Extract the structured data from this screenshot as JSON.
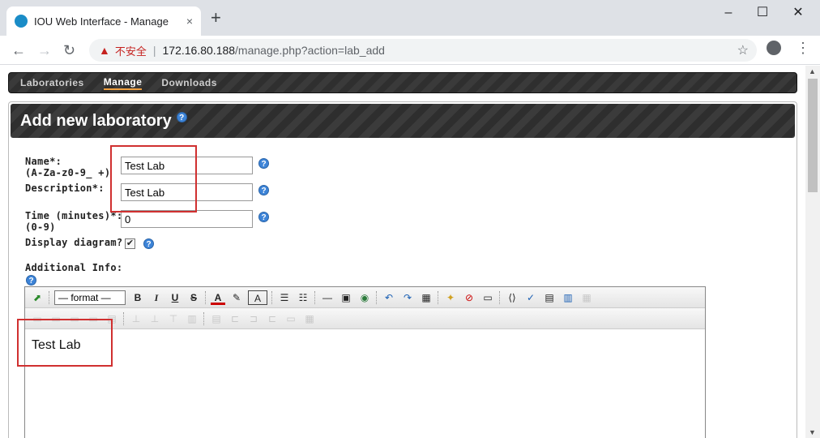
{
  "browser": {
    "tab_title": "IOU Web Interface - Manage",
    "tab_close": "×",
    "new_tab": "+",
    "insecure_label": "不安全",
    "url_host": "172.16.80.188",
    "url_path": "/manage.php?action=lab_add",
    "win_minimize": "–",
    "win_maximize": "☐",
    "win_close": "✕"
  },
  "nav": {
    "items": [
      "Laboratories",
      "Manage",
      "Downloads"
    ],
    "active": "Manage"
  },
  "panel": {
    "title": "Add new laboratory"
  },
  "form": {
    "name_label": "Name*:",
    "name_hint": "(A-Za-z0-9_ +)",
    "name_value": "Test Lab",
    "description_label": "Description*:",
    "description_value": "Test Lab",
    "time_label": "Time (minutes)*:",
    "time_hint": "(0-9)",
    "time_value": "0",
    "diagram_label": "Display diagram?",
    "diagram_checked": "✔",
    "additional_label": "Additional Info:"
  },
  "editor": {
    "format_select": "— format —",
    "content": "Test Lab"
  },
  "colors": {
    "highlight": "#d03030",
    "help_icon": "#3d84d8",
    "active_nav_underline": "#f0a040"
  }
}
